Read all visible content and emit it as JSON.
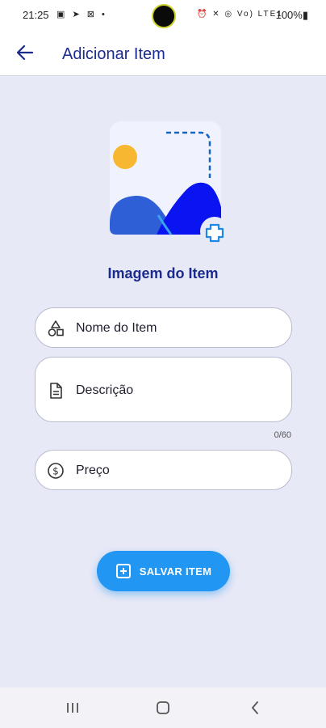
{
  "status_bar": {
    "time": "21:25",
    "left_icons": "▣ ➤ ⊠ •",
    "right_icons": "⏰ ✕ ◎ Vo) LTE1",
    "battery": "100%▮"
  },
  "app_bar": {
    "title": "Adicionar Item",
    "back_icon": "arrow-left-icon"
  },
  "image_picker": {
    "caption": "Imagem do Item",
    "icon": "add-photo-icon",
    "colors": {
      "sun": "#f7b731",
      "hill_left": "#2f5fd6",
      "hill_right": "#0a14f0",
      "plus": "#1e88e5"
    }
  },
  "form": {
    "name_placeholder": "Nome do Item",
    "description_placeholder": "Descrição",
    "description_counter": "0/60",
    "price_placeholder": "Preço"
  },
  "save_button": {
    "label": "SALVAR ITEM",
    "color": "#2196f3"
  },
  "accent_color": "#1b2a8f"
}
